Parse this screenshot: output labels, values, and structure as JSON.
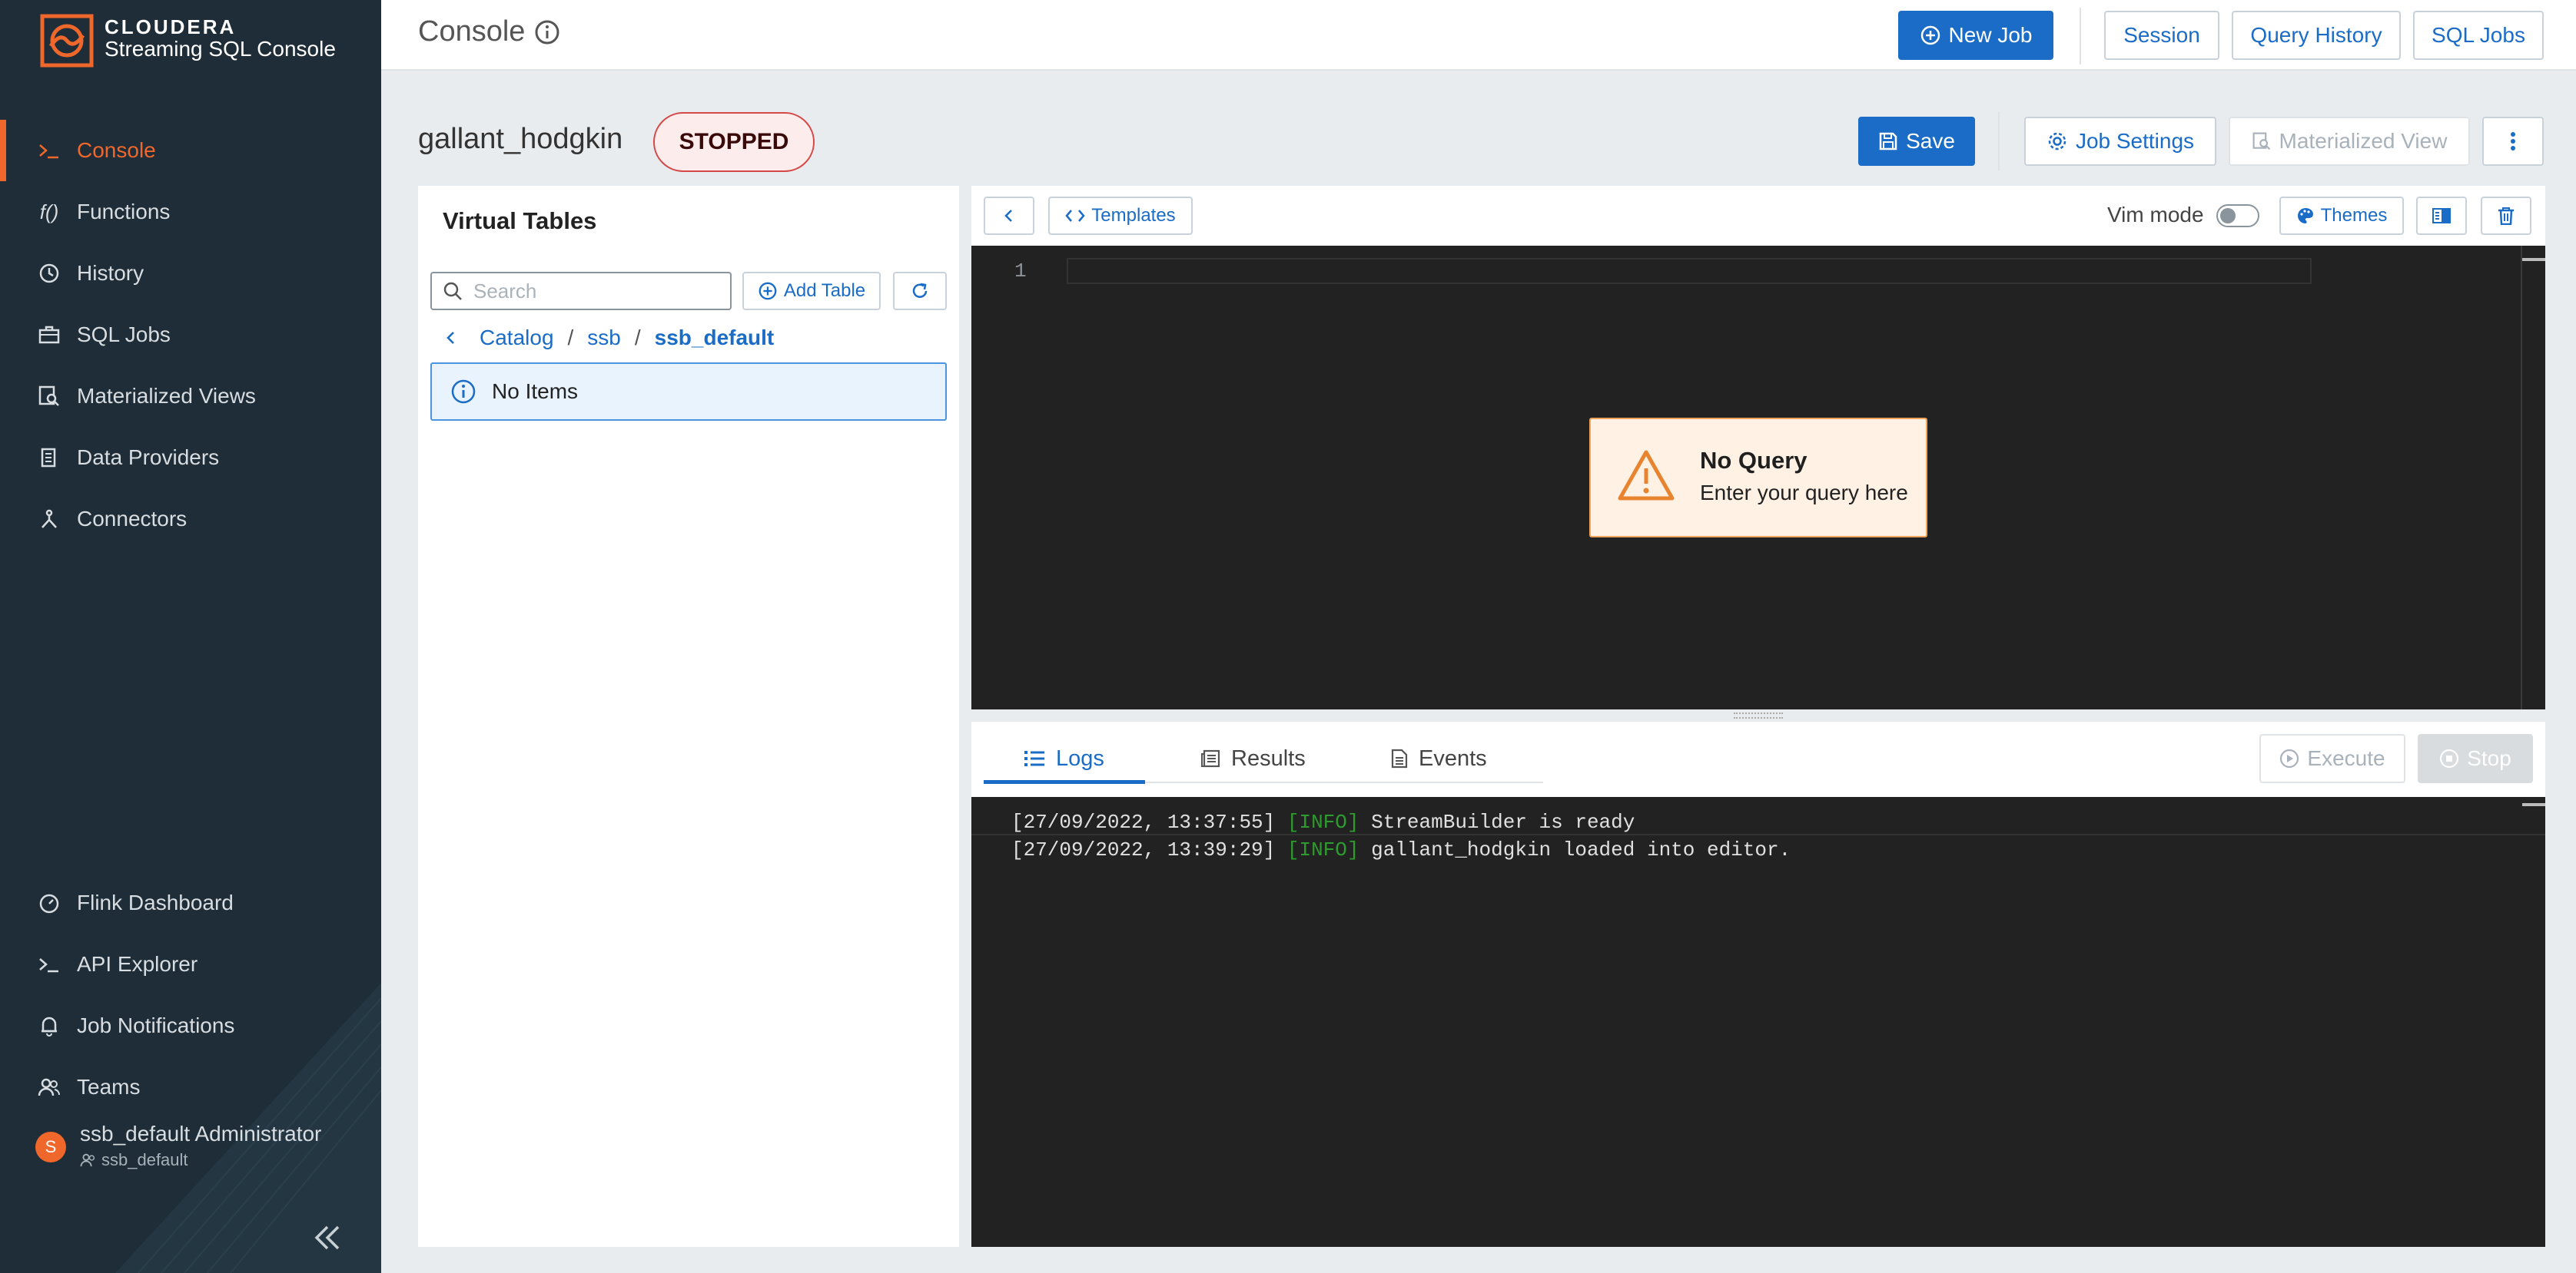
{
  "brand": {
    "name": "CLOUDERA",
    "product": "Streaming SQL Console"
  },
  "sidebar": {
    "items": [
      {
        "label": "Console",
        "active": true
      },
      {
        "label": "Functions"
      },
      {
        "label": "History"
      },
      {
        "label": "SQL Jobs"
      },
      {
        "label": "Materialized Views"
      },
      {
        "label": "Data Providers"
      },
      {
        "label": "Connectors"
      }
    ],
    "bottom_items": [
      {
        "label": "Flink Dashboard"
      },
      {
        "label": "API Explorer"
      },
      {
        "label": "Job Notifications"
      },
      {
        "label": "Teams"
      }
    ],
    "user": {
      "avatar_letter": "S",
      "name": "ssb_default Administrator",
      "team": "ssb_default"
    }
  },
  "header": {
    "title": "Console",
    "new_job": "New Job",
    "session": "Session",
    "query_history": "Query History",
    "sql_jobs": "SQL Jobs"
  },
  "job": {
    "name": "gallant_hodgkin",
    "status": "STOPPED",
    "save": "Save",
    "job_settings": "Job Settings",
    "materialized_view": "Materialized View"
  },
  "virtual_tables": {
    "title": "Virtual Tables",
    "search_placeholder": "Search",
    "add_table": "Add Table",
    "breadcrumb": [
      "Catalog",
      "ssb",
      "ssb_default"
    ],
    "empty_message": "No Items"
  },
  "editor": {
    "templates": "Templates",
    "vim_mode": "Vim mode",
    "themes": "Themes",
    "line_number": "1",
    "alert_title": "No Query",
    "alert_text": "Enter your query here"
  },
  "bottom_panel": {
    "tabs": [
      "Logs",
      "Results",
      "Events"
    ],
    "execute": "Execute",
    "stop": "Stop",
    "logs": [
      {
        "time": "[27/09/2022, 13:37:55]",
        "level": "[INFO]",
        "message": "StreamBuilder is ready"
      },
      {
        "time": "[27/09/2022, 13:39:29]",
        "level": "[INFO]",
        "message": "gallant_hodgkin loaded into editor."
      }
    ]
  },
  "colors": {
    "accent": "#1a6cc6",
    "sidebar_bg": "#1e2d37",
    "brand_orange": "#f0672b",
    "status_stopped": "#d54848"
  }
}
